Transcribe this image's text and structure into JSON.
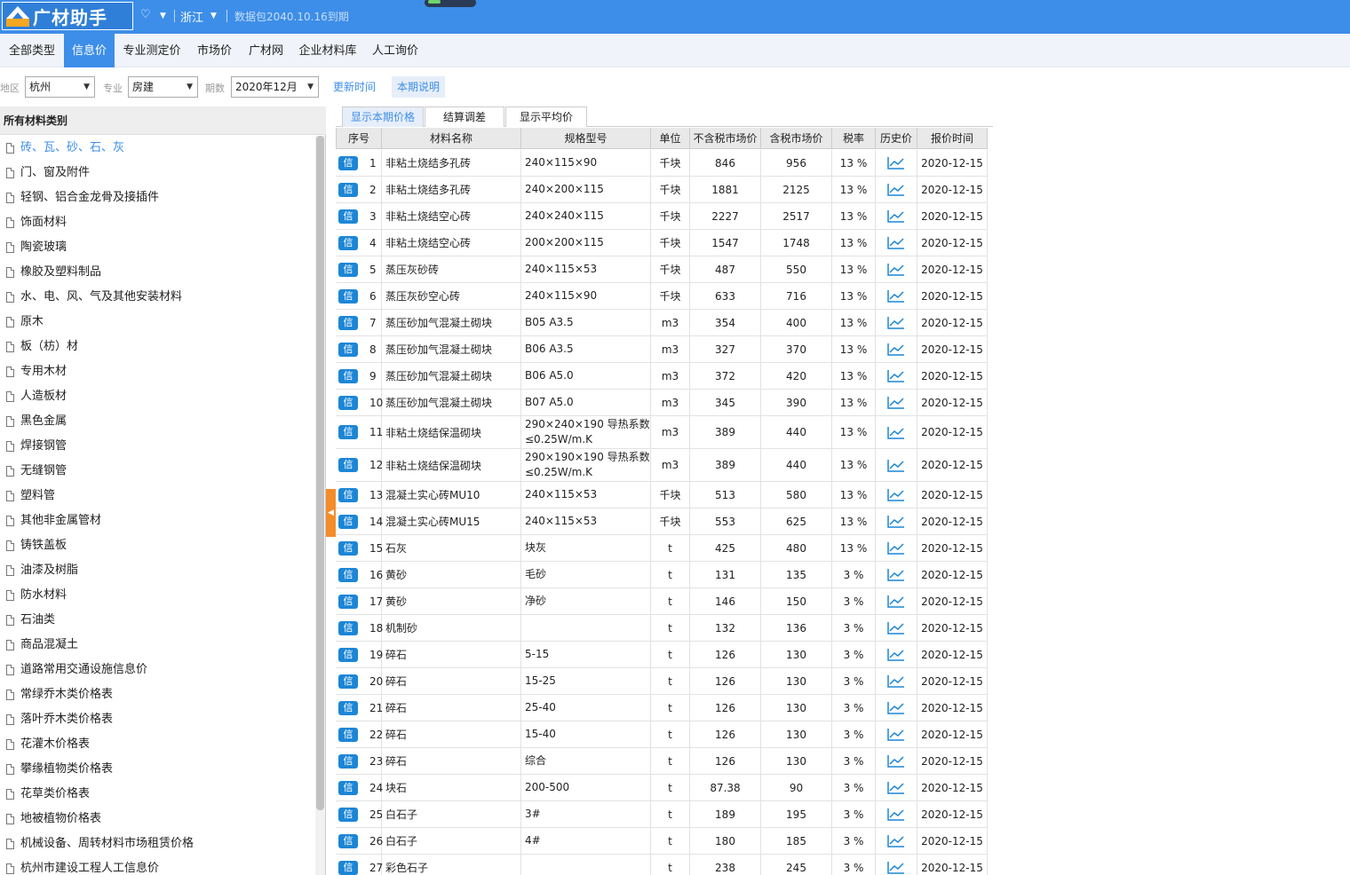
{
  "titlebar": {
    "app_name": "广材助手",
    "region": "浙江",
    "data_package": "数据包2040.10.16到期"
  },
  "tabs": [
    {
      "label": "全部类型"
    },
    {
      "label": "信息价"
    },
    {
      "label": "专业测定价"
    },
    {
      "label": "市场价"
    },
    {
      "label": "广材网"
    },
    {
      "label": "企业材料库"
    },
    {
      "label": "人工询价"
    }
  ],
  "filters": {
    "region_label": "地区",
    "region_value": "杭州",
    "specialty_label": "专业",
    "specialty_value": "房建",
    "period_label": "期数",
    "period_value": "2020年12月",
    "update_time": "更新时间",
    "period_notes": "本期说明"
  },
  "sidebar": {
    "title": "所有材料类别",
    "items": [
      "砖、瓦、砂、石、灰",
      "门、窗及附件",
      "轻钢、铝合金龙骨及接插件",
      "饰面材料",
      "陶瓷玻璃",
      "橡胶及塑料制品",
      "水、电、风、气及其他安装材料",
      "原木",
      "板（枋）材",
      "专用木材",
      "人造板材",
      "黑色金属",
      "焊接钢管",
      "无缝钢管",
      "塑料管",
      "其他非金属管材",
      "铸铁盖板",
      "油漆及树脂",
      "防水材料",
      "石油类",
      "商品混凝土",
      "道路常用交通设施信息价",
      "常绿乔木类价格表",
      "落叶乔木类价格表",
      "花灌木价格表",
      "攀缘植物类价格表",
      "花草类价格表",
      "地被植物价格表",
      "机械设备、周转材料市场租赁价格",
      "杭州市建设工程人工信息价"
    ]
  },
  "subtabs": [
    {
      "label": "显示本期价格"
    },
    {
      "label": "结算调差"
    },
    {
      "label": "显示平均价"
    }
  ],
  "table": {
    "headers": [
      "序号",
      "材料名称",
      "规格型号",
      "单位",
      "不含税市场价",
      "含税市场价",
      "税率",
      "历史价",
      "报价时间"
    ],
    "badge": "信",
    "rows": [
      [
        "1",
        "非粘土烧结多孔砖",
        "240×115×90",
        "千块",
        "846",
        "956",
        "13 %",
        "2020-12-15"
      ],
      [
        "2",
        "非粘土烧结多孔砖",
        "240×200×115",
        "千块",
        "1881",
        "2125",
        "13 %",
        "2020-12-15"
      ],
      [
        "3",
        "非粘土烧结空心砖",
        "240×240×115",
        "千块",
        "2227",
        "2517",
        "13 %",
        "2020-12-15"
      ],
      [
        "4",
        "非粘土烧结空心砖",
        "200×200×115",
        "千块",
        "1547",
        "1748",
        "13 %",
        "2020-12-15"
      ],
      [
        "5",
        "蒸压灰砂砖",
        "240×115×53",
        "千块",
        "487",
        "550",
        "13 %",
        "2020-12-15"
      ],
      [
        "6",
        "蒸压灰砂空心砖",
        "240×115×90",
        "千块",
        "633",
        "716",
        "13 %",
        "2020-12-15"
      ],
      [
        "7",
        "蒸压砂加气混凝土砌块",
        "B05 A3.5",
        "m3",
        "354",
        "400",
        "13 %",
        "2020-12-15"
      ],
      [
        "8",
        "蒸压砂加气混凝土砌块",
        "B06 A3.5",
        "m3",
        "327",
        "370",
        "13 %",
        "2020-12-15"
      ],
      [
        "9",
        "蒸压砂加气混凝土砌块",
        "B06 A5.0",
        "m3",
        "372",
        "420",
        "13 %",
        "2020-12-15"
      ],
      [
        "10",
        "蒸压砂加气混凝土砌块",
        "B07 A5.0",
        "m3",
        "345",
        "390",
        "13 %",
        "2020-12-15"
      ],
      [
        "11",
        "非粘土烧结保温砌块",
        "290×240×190 导热系数≤0.25W/m.K",
        "m3",
        "389",
        "440",
        "13 %",
        "2020-12-15"
      ],
      [
        "12",
        "非粘土烧结保温砌块",
        "290×190×190 导热系数≤0.25W/m.K",
        "m3",
        "389",
        "440",
        "13 %",
        "2020-12-15"
      ],
      [
        "13",
        "混凝土实心砖MU10",
        "240×115×53",
        "千块",
        "513",
        "580",
        "13 %",
        "2020-12-15"
      ],
      [
        "14",
        "混凝土实心砖MU15",
        "240×115×53",
        "千块",
        "553",
        "625",
        "13 %",
        "2020-12-15"
      ],
      [
        "15",
        "石灰",
        "块灰",
        "t",
        "425",
        "480",
        "13 %",
        "2020-12-15"
      ],
      [
        "16",
        "黄砂",
        "毛砂",
        "t",
        "131",
        "135",
        "3 %",
        "2020-12-15"
      ],
      [
        "17",
        "黄砂",
        "净砂",
        "t",
        "146",
        "150",
        "3 %",
        "2020-12-15"
      ],
      [
        "18",
        "机制砂",
        "",
        "t",
        "132",
        "136",
        "3 %",
        "2020-12-15"
      ],
      [
        "19",
        "碎石",
        "5-15",
        "t",
        "126",
        "130",
        "3 %",
        "2020-12-15"
      ],
      [
        "20",
        "碎石",
        "15-25",
        "t",
        "126",
        "130",
        "3 %",
        "2020-12-15"
      ],
      [
        "21",
        "碎石",
        "25-40",
        "t",
        "126",
        "130",
        "3 %",
        "2020-12-15"
      ],
      [
        "22",
        "碎石",
        "15-40",
        "t",
        "126",
        "130",
        "3 %",
        "2020-12-15"
      ],
      [
        "23",
        "碎石",
        "综合",
        "t",
        "126",
        "130",
        "3 %",
        "2020-12-15"
      ],
      [
        "24",
        "块石",
        "200-500",
        "t",
        "87.38",
        "90",
        "3 %",
        "2020-12-15"
      ],
      [
        "25",
        "白石子",
        "3#",
        "t",
        "189",
        "195",
        "3 %",
        "2020-12-15"
      ],
      [
        "26",
        "白石子",
        "4#",
        "t",
        "180",
        "185",
        "3 %",
        "2020-12-15"
      ],
      [
        "27",
        "彩色石子",
        "",
        "t",
        "238",
        "245",
        "3 %",
        "2020-12-15"
      ]
    ]
  },
  "colors": {
    "primary": "#3d8ee8",
    "badge": "#1c86d6",
    "collapse_handle": "#f38c2a"
  },
  "icons": {
    "logo": "logo-icon",
    "diamond": "diamond-icon",
    "history": "line-chart-icon",
    "document": "document-icon"
  }
}
